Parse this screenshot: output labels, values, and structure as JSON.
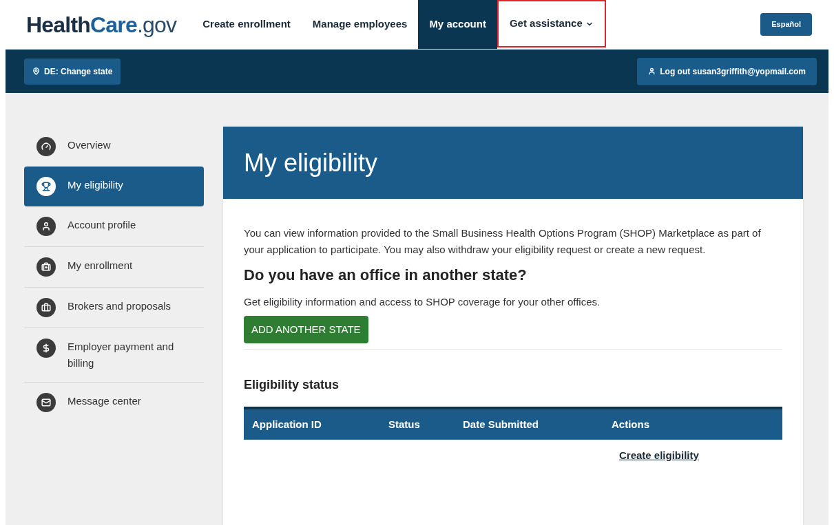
{
  "header": {
    "logo": {
      "main": "Health",
      "accent": "Care",
      "suffix": ".gov"
    },
    "nav": [
      {
        "label": "Create enrollment",
        "selected": false,
        "highlighted": false,
        "dropdown": false
      },
      {
        "label": "Manage employees",
        "selected": false,
        "highlighted": false,
        "dropdown": false
      },
      {
        "label": "My account",
        "selected": true,
        "highlighted": false,
        "dropdown": false
      },
      {
        "label": "Get assistance",
        "selected": false,
        "highlighted": true,
        "dropdown": true
      }
    ],
    "language_button": "Español"
  },
  "subbar": {
    "state_button": "DE: Change state",
    "logout_button": "Log out susan3griffith@yopmail.com"
  },
  "sidebar": {
    "items": [
      {
        "label": "Overview",
        "selected": false
      },
      {
        "label": "My eligibility",
        "selected": true
      },
      {
        "label": "Account profile",
        "selected": false
      },
      {
        "label": "My enrollment",
        "selected": false
      },
      {
        "label": "Brokers and proposals",
        "selected": false
      },
      {
        "label": "Employer payment and billing",
        "selected": false
      },
      {
        "label": "Message center",
        "selected": false
      }
    ]
  },
  "main": {
    "title": "My eligibility",
    "intro": "You can view information provided to the Small Business Health Options Program (SHOP) Marketplace as part of your application to participate. You may also withdraw your eligibility request or create a new request.",
    "office_heading": "Do you have an office in another state?",
    "office_text": "Get eligibility information and access to SHOP coverage for your other offices.",
    "add_state_button": "ADD ANOTHER STATE",
    "status_heading": "Eligibility status",
    "table": {
      "columns": [
        "Application ID",
        "Status",
        "Date Submitted",
        "Actions"
      ],
      "action_link": "Create eligibility"
    }
  }
}
